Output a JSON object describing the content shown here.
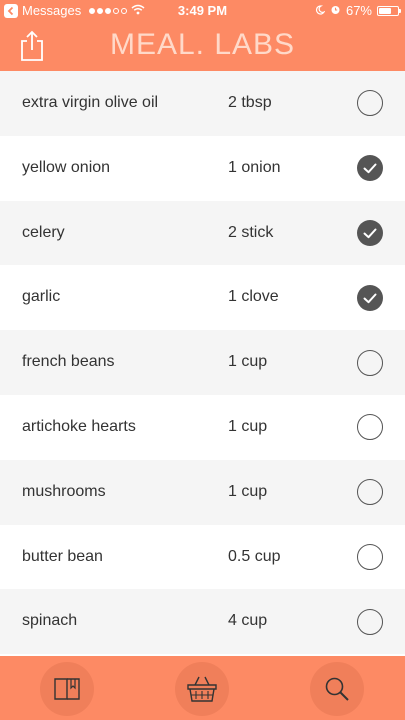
{
  "status_bar": {
    "back_app": "Messages",
    "time": "3:49 PM",
    "battery": "67%",
    "battery_level": 0.67
  },
  "header": {
    "title": "MEAL. LABS"
  },
  "ingredients": [
    {
      "name": "extra virgin olive oil",
      "quantity": "2 tbsp",
      "checked": false
    },
    {
      "name": "yellow onion",
      "quantity": "1 onion",
      "checked": true
    },
    {
      "name": "celery",
      "quantity": "2 stick",
      "checked": true
    },
    {
      "name": "garlic",
      "quantity": "1 clove",
      "checked": true
    },
    {
      "name": "french beans",
      "quantity": "1 cup",
      "checked": false
    },
    {
      "name": "artichoke hearts",
      "quantity": "1 cup",
      "checked": false
    },
    {
      "name": "mushrooms",
      "quantity": "1 cup",
      "checked": false
    },
    {
      "name": "butter bean",
      "quantity": "0.5 cup",
      "checked": false
    },
    {
      "name": "spinach",
      "quantity": "4 cup",
      "checked": false
    }
  ],
  "tabbar": {
    "tabs": [
      {
        "icon": "book-icon"
      },
      {
        "icon": "basket-icon"
      },
      {
        "icon": "search-icon"
      }
    ]
  },
  "colors": {
    "accent": "#fd8a64",
    "accent_dark": "#f07f5a",
    "title_text": "#ffd9c9",
    "checkbox": "#555555",
    "row_shade": "#f5f5f5"
  }
}
